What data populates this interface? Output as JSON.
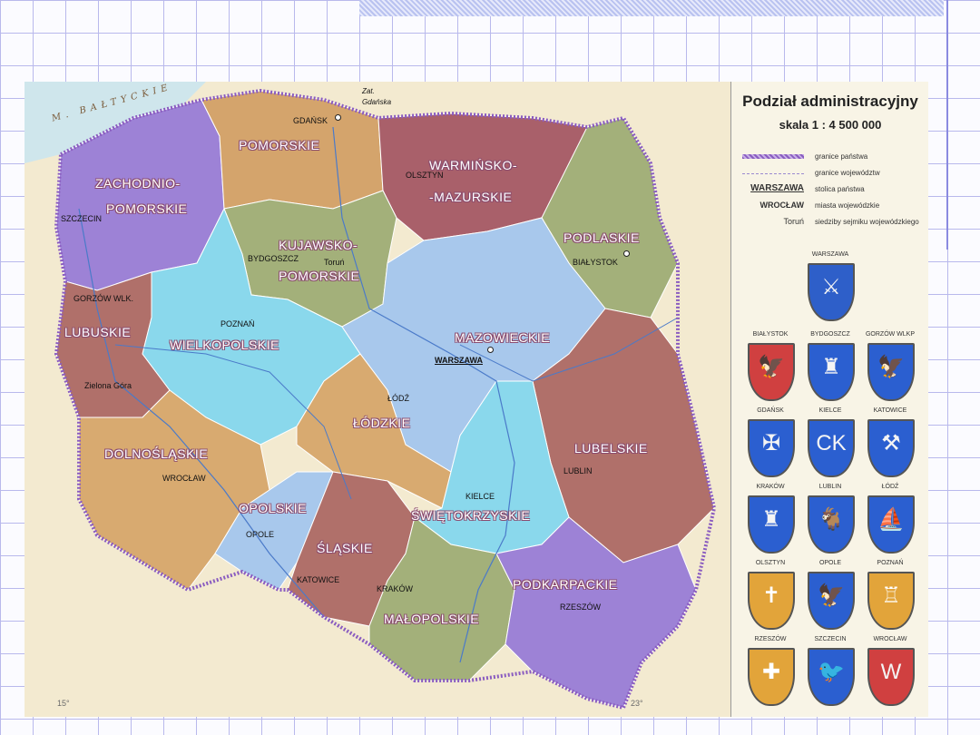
{
  "legend": {
    "title": "Podział administracyjny",
    "scale": "skala 1 : 4 500 000",
    "items": [
      {
        "symbol": "",
        "text": "granice państwa"
      },
      {
        "symbol": "",
        "text": "granice województw"
      },
      {
        "symbol": "WARSZAWA",
        "text": "stolica państwa"
      },
      {
        "symbol": "WROCŁAW",
        "text": "miasta wojewódzkie"
      },
      {
        "symbol": "Toruń",
        "text": "siedziby sejmiku wojewódzkiego"
      }
    ],
    "coats": [
      {
        "name": "WARSZAWA",
        "emblem": "⚔",
        "color": "#2e5fc9"
      },
      {
        "name": "BIAŁYSTOK",
        "emblem": "🦅",
        "color": "#d04040"
      },
      {
        "name": "BYDGOSZCZ",
        "emblem": "♜",
        "color": "#2b5fd0"
      },
      {
        "name": "GORZÓW WLKP",
        "emblem": "🦅",
        "color": "#2b5fd0"
      },
      {
        "name": "GDAŃSK",
        "emblem": "✠",
        "color": "#2b5fd0"
      },
      {
        "name": "KIELCE",
        "emblem": "CK",
        "color": "#2b5fd0"
      },
      {
        "name": "KATOWICE",
        "emblem": "⚒",
        "color": "#2b5fd0"
      },
      {
        "name": "KRAKÓW",
        "emblem": "♜",
        "color": "#2b5fd0"
      },
      {
        "name": "LUBLIN",
        "emblem": "🐐",
        "color": "#2b5fd0"
      },
      {
        "name": "ŁÓDŹ",
        "emblem": "⛵",
        "color": "#2b5fd0"
      },
      {
        "name": "OLSZTYN",
        "emblem": "✝",
        "color": "#e2a43a"
      },
      {
        "name": "OPOLE",
        "emblem": "🦅",
        "color": "#2b5fd0"
      },
      {
        "name": "POZNAŃ",
        "emblem": "♖",
        "color": "#e2a43a"
      },
      {
        "name": "RZESZÓW",
        "emblem": "✚",
        "color": "#e2a43a"
      },
      {
        "name": "SZCZECIN",
        "emblem": "🐦",
        "color": "#2b5fd0"
      },
      {
        "name": "WROCŁAW",
        "emblem": "W",
        "color": "#d04040"
      }
    ]
  },
  "map": {
    "sea_label": "M. BAŁTYCKIE",
    "small_labels": [
      "Zat.",
      "Gdańska"
    ],
    "provinces": [
      {
        "name": "ZACHODNIO-",
        "name2": "POMORSKIE",
        "color": "#9d82d6"
      },
      {
        "name": "POMORSKIE",
        "color": "#d4a46c"
      },
      {
        "name": "WARMIŃSKO-",
        "name2": "-MAZURSKIE",
        "color": "#a9606a"
      },
      {
        "name": "PODLASKIE",
        "color": "#a3b07a"
      },
      {
        "name": "KUJAWSKO-",
        "name2": "POMORSKIE",
        "color": "#a3b07a"
      },
      {
        "name": "LUBUSKIE",
        "color": "#b0706a"
      },
      {
        "name": "WIELKOPOLSKIE",
        "color": "#8ad8ec"
      },
      {
        "name": "MAZOWIECKIE",
        "color": "#a8c8ec"
      },
      {
        "name": "ŁÓDZKIE",
        "color": "#d8aa70"
      },
      {
        "name": "LUBELSKIE",
        "color": "#b0706a"
      },
      {
        "name": "DOLNOŚLĄSKIE",
        "color": "#d8aa70"
      },
      {
        "name": "OPOLSKIE",
        "color": "#a8c8ec"
      },
      {
        "name": "ŚLĄSKIE",
        "color": "#b0706a"
      },
      {
        "name": "ŚWIĘTOKRZYSKIE",
        "color": "#8ad8ec"
      },
      {
        "name": "MAŁOPOLSKIE",
        "color": "#a3b07a"
      },
      {
        "name": "PODKARPACKIE",
        "color": "#9d82d6"
      }
    ],
    "cities": [
      "GDAŃSK",
      "OLSZTYN",
      "SZCZECIN",
      "BYDGOSZCZ",
      "Toruń",
      "BIAŁYSTOK",
      "GORZÓW WLK.",
      "POZNAŃ",
      "WARSZAWA",
      "Zielona Góra",
      "ŁÓDŹ",
      "WROCŁAW",
      "LUBLIN",
      "KIELCE",
      "OPOLE",
      "KATOWICE",
      "KRAKÓW",
      "RZESZÓW"
    ],
    "grid_labels": [
      "15°",
      "23°"
    ]
  }
}
